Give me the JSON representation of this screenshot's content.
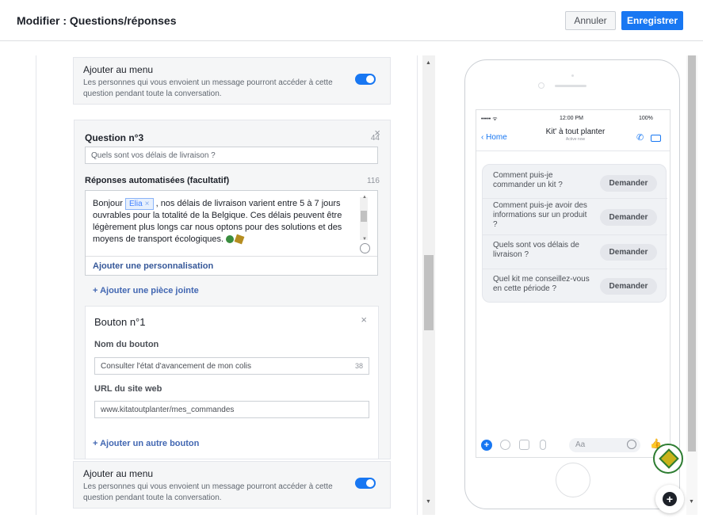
{
  "header": {
    "title": "Modifier : Questions/réponses",
    "cancel_label": "Annuler",
    "save_label": "Enregistrer"
  },
  "menu_top": {
    "title": "Ajouter au menu",
    "description": "Les personnes qui vous envoient un message pourront accéder à cette question pendant toute la conversation.",
    "enabled": true
  },
  "question": {
    "label": "Question n°3",
    "count": "44",
    "value": "Quels sont vos délais de livraison ?",
    "responses_label": "Réponses automatisées (facultatif)",
    "responses_count": "116",
    "response_before_tag": "Bonjour ",
    "tag_label": "Elia",
    "tag_close": "×",
    "response_after_tag": ", nos délais de livraison varient entre 5 à 7 jours ouvrables pour la totalité de la Belgique. Ces délais peuvent être légèrement plus longs car nous optons pour des solutions et des moyens de transport écologiques.",
    "personalization_label": "Ajouter une personnalisation",
    "add_attachment_label": "+ Ajouter une pièce jointe"
  },
  "button_card": {
    "title": "Bouton n°1",
    "name_label": "Nom du bouton",
    "name_value": "Consulter l'état d'avancement de mon colis",
    "name_count": "38",
    "url_label": "URL du site web",
    "url_value": "www.kitatoutplanter/mes_commandes",
    "add_button_label": "+ Ajouter un autre bouton"
  },
  "menu_bottom": {
    "title": "Ajouter au menu",
    "description": "Les personnes qui vous envoient un message pourront accéder à cette question pendant toute la conversation.",
    "enabled": true
  },
  "phone": {
    "status_carrier": "••••• ᯤ",
    "status_time": "12:00 PM",
    "status_battery": "100%",
    "back_label": "Home",
    "chat_title": "Kit' à tout planter",
    "chat_subtitle": "Active now",
    "quick_replies": [
      {
        "question": "Comment puis-je commander un kit ?",
        "button": "Demander"
      },
      {
        "question": "Comment puis-je avoir des informations sur un produit ?",
        "button": "Demander"
      },
      {
        "question": "Quels sont vos délais de livraison ?",
        "button": "Demander"
      },
      {
        "question": "Quel kit me conseillez-vous en cette période ?",
        "button": "Demander"
      }
    ],
    "composer_placeholder": "Aa"
  },
  "colors": {
    "accent": "#1877f2",
    "link": "#4267b2"
  }
}
